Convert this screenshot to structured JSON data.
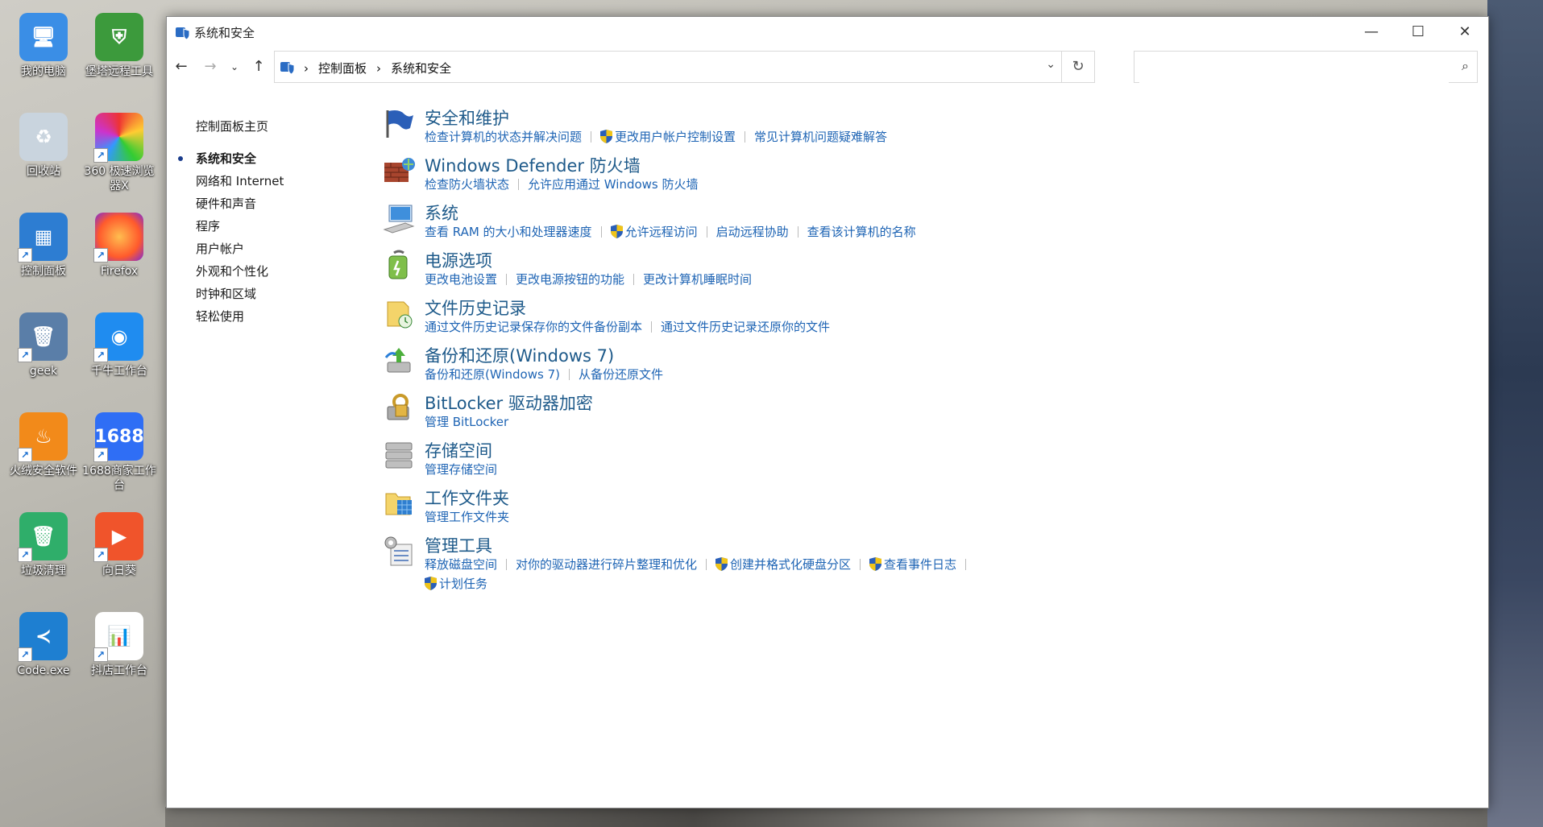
{
  "desktop": {
    "icons": [
      {
        "label": "我的电脑",
        "icon": "computer-icon"
      },
      {
        "label": "堡塔远程工具",
        "icon": "baota-icon"
      },
      {
        "label": "回收站",
        "icon": "recycle-bin-icon"
      },
      {
        "label": "360 极速浏览器X",
        "icon": "360-browser-icon"
      },
      {
        "label": "控制面板",
        "icon": "control-panel-icon"
      },
      {
        "label": "Firefox",
        "icon": "firefox-icon"
      },
      {
        "label": "geek",
        "icon": "geek-icon"
      },
      {
        "label": "千牛工作台",
        "icon": "qianniu-icon"
      },
      {
        "label": "火绒安全软件",
        "icon": "huorong-icon"
      },
      {
        "label": "1688商家工作台",
        "icon": "1688-icon"
      },
      {
        "label": "垃圾清理",
        "icon": "cleanup-icon"
      },
      {
        "label": "向日葵",
        "icon": "sunflower-icon"
      },
      {
        "label": "Code.exe",
        "icon": "vscode-icon"
      },
      {
        "label": "抖店工作台",
        "icon": "doudian-icon"
      }
    ],
    "badge_1688": "1688"
  },
  "window": {
    "title": "系统和安全",
    "minimize": "—",
    "maximize": "☐",
    "close": "✕"
  },
  "nav": {
    "back": "←",
    "forward": "→",
    "recent": "⌄",
    "up": "↑",
    "breadcrumbs": [
      "控制面板",
      "系统和安全"
    ],
    "breadcrumb_sep": "›",
    "dropdown": "⌄",
    "refresh": "↻",
    "search_value": "",
    "search_icon": "⌕"
  },
  "sidebar": {
    "home": "控制面板主页",
    "items": [
      "系统和安全",
      "网络和 Internet",
      "硬件和声音",
      "程序",
      "用户帐户",
      "外观和个性化",
      "时钟和区域",
      "轻松使用"
    ],
    "current_index": 0
  },
  "categories": [
    {
      "title": "安全和维护",
      "icon": "flag-icon",
      "links": [
        {
          "text": "检查计算机的状态并解决问题",
          "shield": false
        },
        {
          "text": "更改用户帐户控制设置",
          "shield": true
        },
        {
          "text": "常见计算机问题疑难解答",
          "shield": false
        }
      ]
    },
    {
      "title": "Windows Defender 防火墙",
      "icon": "firewall-icon",
      "links": [
        {
          "text": "检查防火墙状态",
          "shield": false
        },
        {
          "text": "允许应用通过 Windows 防火墙",
          "shield": false
        }
      ]
    },
    {
      "title": "系统",
      "icon": "system-icon",
      "links": [
        {
          "text": "查看 RAM 的大小和处理器速度",
          "shield": false
        },
        {
          "text": "允许远程访问",
          "shield": true
        },
        {
          "text": "启动远程协助",
          "shield": false
        },
        {
          "text": "查看该计算机的名称",
          "shield": false
        }
      ]
    },
    {
      "title": "电源选项",
      "icon": "power-options-icon",
      "links": [
        {
          "text": "更改电池设置",
          "shield": false
        },
        {
          "text": "更改电源按钮的功能",
          "shield": false
        },
        {
          "text": "更改计算机睡眠时间",
          "shield": false
        }
      ]
    },
    {
      "title": "文件历史记录",
      "icon": "file-history-icon",
      "links": [
        {
          "text": "通过文件历史记录保存你的文件备份副本",
          "shield": false
        },
        {
          "text": "通过文件历史记录还原你的文件",
          "shield": false
        }
      ]
    },
    {
      "title": "备份和还原(Windows 7)",
      "icon": "backup-icon",
      "links": [
        {
          "text": "备份和还原(Windows 7)",
          "shield": false
        },
        {
          "text": "从备份还原文件",
          "shield": false
        }
      ]
    },
    {
      "title": "BitLocker 驱动器加密",
      "icon": "bitlocker-icon",
      "links": [
        {
          "text": "管理 BitLocker",
          "shield": false
        }
      ]
    },
    {
      "title": "存储空间",
      "icon": "storage-spaces-icon",
      "links": [
        {
          "text": "管理存储空间",
          "shield": false
        }
      ]
    },
    {
      "title": "工作文件夹",
      "icon": "work-folders-icon",
      "links": [
        {
          "text": "管理工作文件夹",
          "shield": false
        }
      ]
    },
    {
      "title": "管理工具",
      "icon": "admin-tools-icon",
      "links": [
        {
          "text": "释放磁盘空间",
          "shield": false
        },
        {
          "text": "对你的驱动器进行碎片整理和优化",
          "shield": false
        },
        {
          "text": "创建并格式化硬盘分区",
          "shield": true
        },
        {
          "text": "查看事件日志",
          "shield": true
        }
      ],
      "links_row2": [
        {
          "text": "计划任务",
          "shield": true
        }
      ]
    }
  ],
  "colors": {
    "accent_title": "#1e5a8a",
    "link": "#1e64b4"
  }
}
